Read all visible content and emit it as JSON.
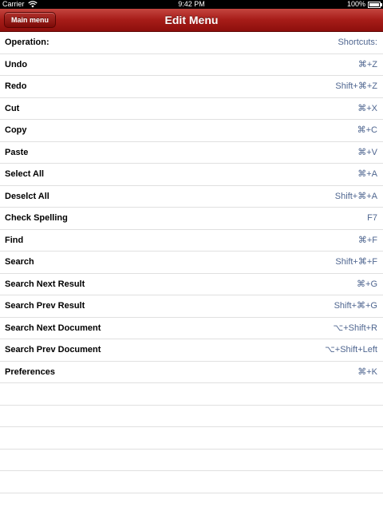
{
  "status_bar": {
    "carrier": "Carrier",
    "time": "9:42 PM",
    "battery": "100%"
  },
  "nav": {
    "back_label": "Main menu",
    "title": "Edit Menu"
  },
  "header_row": {
    "label": "Operation:",
    "shortcut": "Shortcuts:"
  },
  "items": [
    {
      "label": "Undo",
      "shortcut": "⌘+Z"
    },
    {
      "label": "Redo",
      "shortcut": "Shift+⌘+Z"
    },
    {
      "label": "Cut",
      "shortcut": "⌘+X"
    },
    {
      "label": "Copy",
      "shortcut": "⌘+C"
    },
    {
      "label": "Paste",
      "shortcut": "⌘+V"
    },
    {
      "label": "Select All",
      "shortcut": "⌘+A"
    },
    {
      "label": "Deselct All",
      "shortcut": "Shift+⌘+A"
    },
    {
      "label": "Check Spelling",
      "shortcut": "F7"
    },
    {
      "label": "Find",
      "shortcut": "⌘+F"
    },
    {
      "label": "Search",
      "shortcut": "Shift+⌘+F"
    },
    {
      "label": "Search Next Result",
      "shortcut": "⌘+G"
    },
    {
      "label": "Search Prev Result",
      "shortcut": "Shift+⌘+G"
    },
    {
      "label": "Search Next Document",
      "shortcut": "⌥+Shift+R"
    },
    {
      "label": "Search Prev Document",
      "shortcut": "⌥+Shift+Left"
    },
    {
      "label": "Preferences",
      "shortcut": "⌘+K"
    }
  ],
  "colors": {
    "nav_red": "#a61c18",
    "shortcut_blue": "#4f6690",
    "separator": "#e0e0e0"
  }
}
